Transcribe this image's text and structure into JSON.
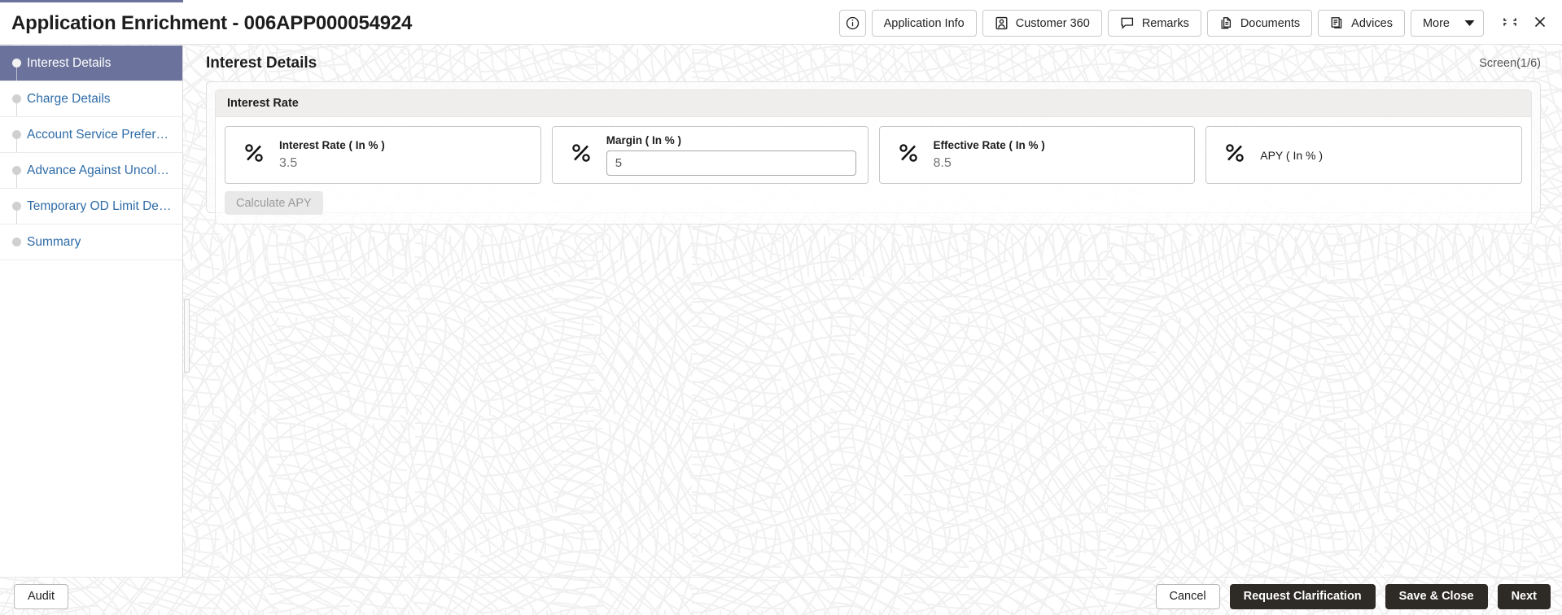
{
  "window": {
    "title": "Application Enrichment - 006APP000054924",
    "accent_color": "#6b739c",
    "minimize_icon": "collapse-icon",
    "close_icon": "close-icon"
  },
  "header": {
    "actions": [
      {
        "icon": "info-circle-icon",
        "label": ""
      },
      {
        "icon": "",
        "label": "Application Info"
      },
      {
        "icon": "user-square-icon",
        "label": "Customer 360"
      },
      {
        "icon": "comment-icon",
        "label": "Remarks"
      },
      {
        "icon": "documents-icon",
        "label": "Documents"
      },
      {
        "icon": "advices-icon",
        "label": "Advices"
      },
      {
        "icon": "chevron-down-icon",
        "label": "More"
      }
    ]
  },
  "sidebar": {
    "items": [
      {
        "label": "Interest Details",
        "active": true
      },
      {
        "label": "Charge Details",
        "active": false
      },
      {
        "label": "Account Service Preference",
        "active": false
      },
      {
        "label": "Advance Against Uncollected Funds",
        "active": false
      },
      {
        "label": "Temporary OD Limit Details",
        "active": false
      },
      {
        "label": "Summary",
        "active": false
      }
    ]
  },
  "main": {
    "page_title": "Interest Details",
    "screen_counter": "Screen(1/6)",
    "section": {
      "title": "Interest Rate",
      "cards": [
        {
          "icon": "percent-icon",
          "label": "Interest Rate ( In % )",
          "value": "3.5",
          "type": "readonly"
        },
        {
          "icon": "percent-icon",
          "label": "Margin ( In % )",
          "value": "5",
          "placeholder": "",
          "type": "input"
        },
        {
          "icon": "percent-icon",
          "label": "Effective Rate ( In % )",
          "value": "8.5",
          "type": "readonly"
        },
        {
          "icon": "percent-icon",
          "label": "APY ( In % )",
          "value": "",
          "type": "empty"
        }
      ],
      "calculate_label": "Calculate APY",
      "calculate_disabled": true
    }
  },
  "footer": {
    "audit_label": "Audit",
    "actions": [
      {
        "label": "Cancel",
        "style": "ghost"
      },
      {
        "label": "Request Clarification",
        "style": "primary"
      },
      {
        "label": "Save & Close",
        "style": "primary"
      },
      {
        "label": "Next",
        "style": "primary"
      }
    ]
  }
}
